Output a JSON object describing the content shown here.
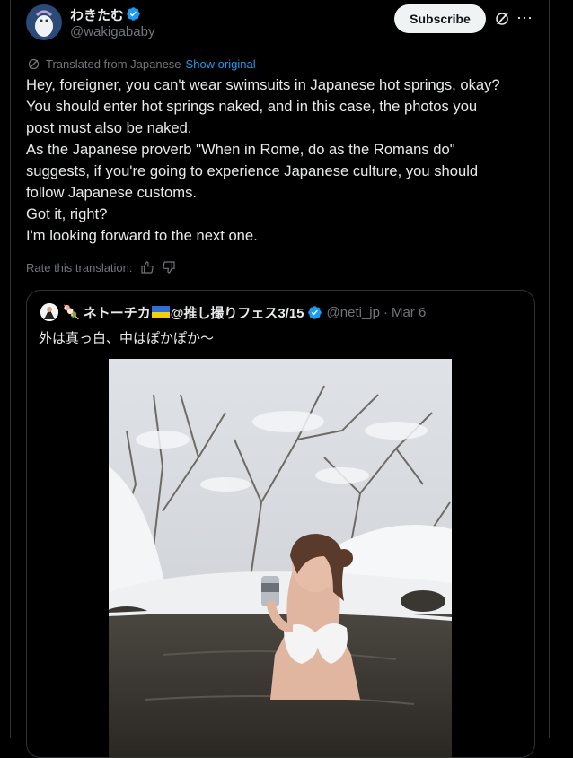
{
  "author": {
    "display_name": "わきたむ",
    "handle": "@wakigababy"
  },
  "actions": {
    "subscribe_label": "Subscribe",
    "more_label": "···"
  },
  "translation": {
    "note": "Translated from Japanese",
    "show_original": "Show original"
  },
  "tweet_lines": [
    "Hey, foreigner, you can't wear swimsuits in Japanese hot springs, okay?",
    "You should enter hot springs naked, and in this case, the photos you",
    "post must also be naked.",
    "As the Japanese proverb \"When in Rome, do as the Romans do\"",
    "suggests, if you're going to experience Japanese culture, you should",
    "follow Japanese customs.",
    "Got it, right?",
    "I'm looking forward to the next one."
  ],
  "rate": {
    "label": "Rate this translation:"
  },
  "quote": {
    "emoji_prefix": "🍡",
    "name": "ネトーチカ",
    "name_suffix": "@推し撮りフェス3/15",
    "handle": "@neti_jp",
    "separator": "·",
    "date": "Mar 6",
    "text": "外は真っ白、中はぽかぽか〜"
  },
  "colors": {
    "accent": "#1d9bf0",
    "muted": "#71767b",
    "text": "#e7e9ea",
    "background": "#000000"
  }
}
